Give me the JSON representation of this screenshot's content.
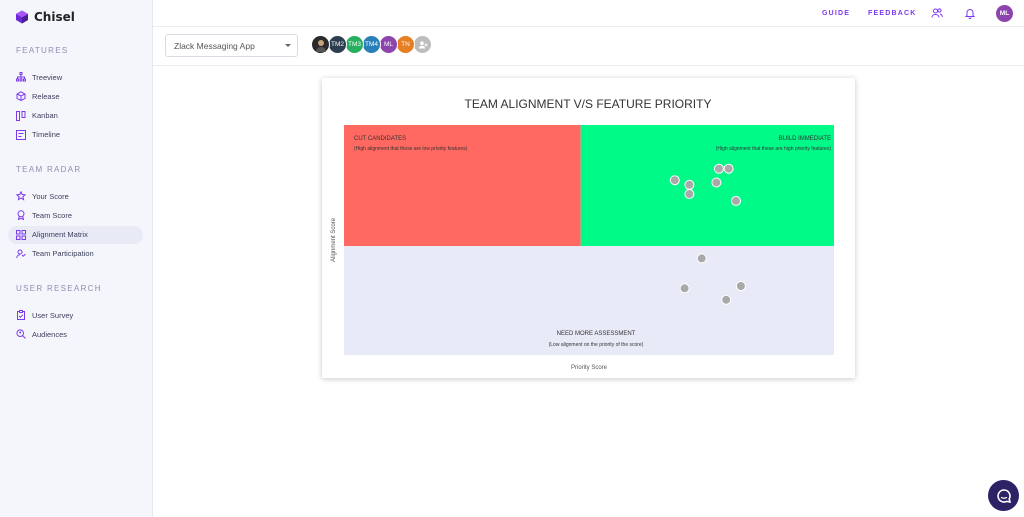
{
  "app": {
    "name": "Chisel"
  },
  "sidebar": {
    "sections": [
      {
        "title": "FEATURES",
        "items": [
          {
            "label": "Treeview",
            "icon": "tree-icon"
          },
          {
            "label": "Release",
            "icon": "cube-icon"
          },
          {
            "label": "Kanban",
            "icon": "kanban-icon"
          },
          {
            "label": "Timeline",
            "icon": "timeline-icon"
          }
        ]
      },
      {
        "title": "TEAM RADAR",
        "items": [
          {
            "label": "Your Score",
            "icon": "star-icon"
          },
          {
            "label": "Team Score",
            "icon": "award-icon"
          },
          {
            "label": "Alignment Matrix",
            "icon": "grid-icon",
            "active": true
          },
          {
            "label": "Team Participation",
            "icon": "participation-icon"
          }
        ]
      },
      {
        "title": "USER RESEARCH",
        "items": [
          {
            "label": "User Survey",
            "icon": "clipboard-icon"
          },
          {
            "label": "Audiences",
            "icon": "search-people-icon"
          }
        ]
      }
    ]
  },
  "topbar": {
    "guide": "GUIDE",
    "feedback": "FEEDBACK",
    "user_initials": "ML"
  },
  "subheader": {
    "project": "Zlack Messaging App",
    "members": [
      {
        "initials": "",
        "color": "#2b2b2b",
        "photo": true
      },
      {
        "initials": "TM2",
        "color": "#2c3e50"
      },
      {
        "initials": "TM3",
        "color": "#27ae60"
      },
      {
        "initials": "TM4",
        "color": "#2980b9"
      },
      {
        "initials": "ML",
        "color": "#8e44ad"
      },
      {
        "initials": "TN",
        "color": "#e67e22"
      },
      {
        "initials": "",
        "color": "#bdbdbd",
        "add": true
      }
    ]
  },
  "chart_data": {
    "type": "scatter",
    "title": "TEAM ALIGNMENT V/S FEATURE PRIORITY",
    "xlabel": "Priority Score",
    "ylabel": "Alignment Score",
    "xlim": [
      0,
      10
    ],
    "ylim": [
      0,
      10
    ],
    "quadrants": [
      {
        "title": "CUT CANDIDATES",
        "subtitle": "(High alignment that these are low priority features)",
        "color": "#ff6961"
      },
      {
        "title": "BUILD IMMEDIATE",
        "subtitle": "(High alignment that these are high priority features)",
        "color": "#00fa88"
      },
      {
        "title": "NEED MORE ASSESSMENT",
        "subtitle": "(Low alignment on the priority of the score)",
        "color": "#e8ebf7"
      }
    ],
    "points": [
      {
        "x": 6.75,
        "y": 7.6
      },
      {
        "x": 7.05,
        "y": 7.4
      },
      {
        "x": 7.05,
        "y": 7.0
      },
      {
        "x": 7.65,
        "y": 8.1
      },
      {
        "x": 7.85,
        "y": 8.1
      },
      {
        "x": 7.6,
        "y": 7.5
      },
      {
        "x": 8.0,
        "y": 6.7
      },
      {
        "x": 7.3,
        "y": 4.2
      },
      {
        "x": 6.95,
        "y": 2.9
      },
      {
        "x": 8.1,
        "y": 3.0
      },
      {
        "x": 7.8,
        "y": 2.4
      }
    ]
  },
  "colors": {
    "accent": "#7c3aed",
    "chat": "#2d2266"
  }
}
